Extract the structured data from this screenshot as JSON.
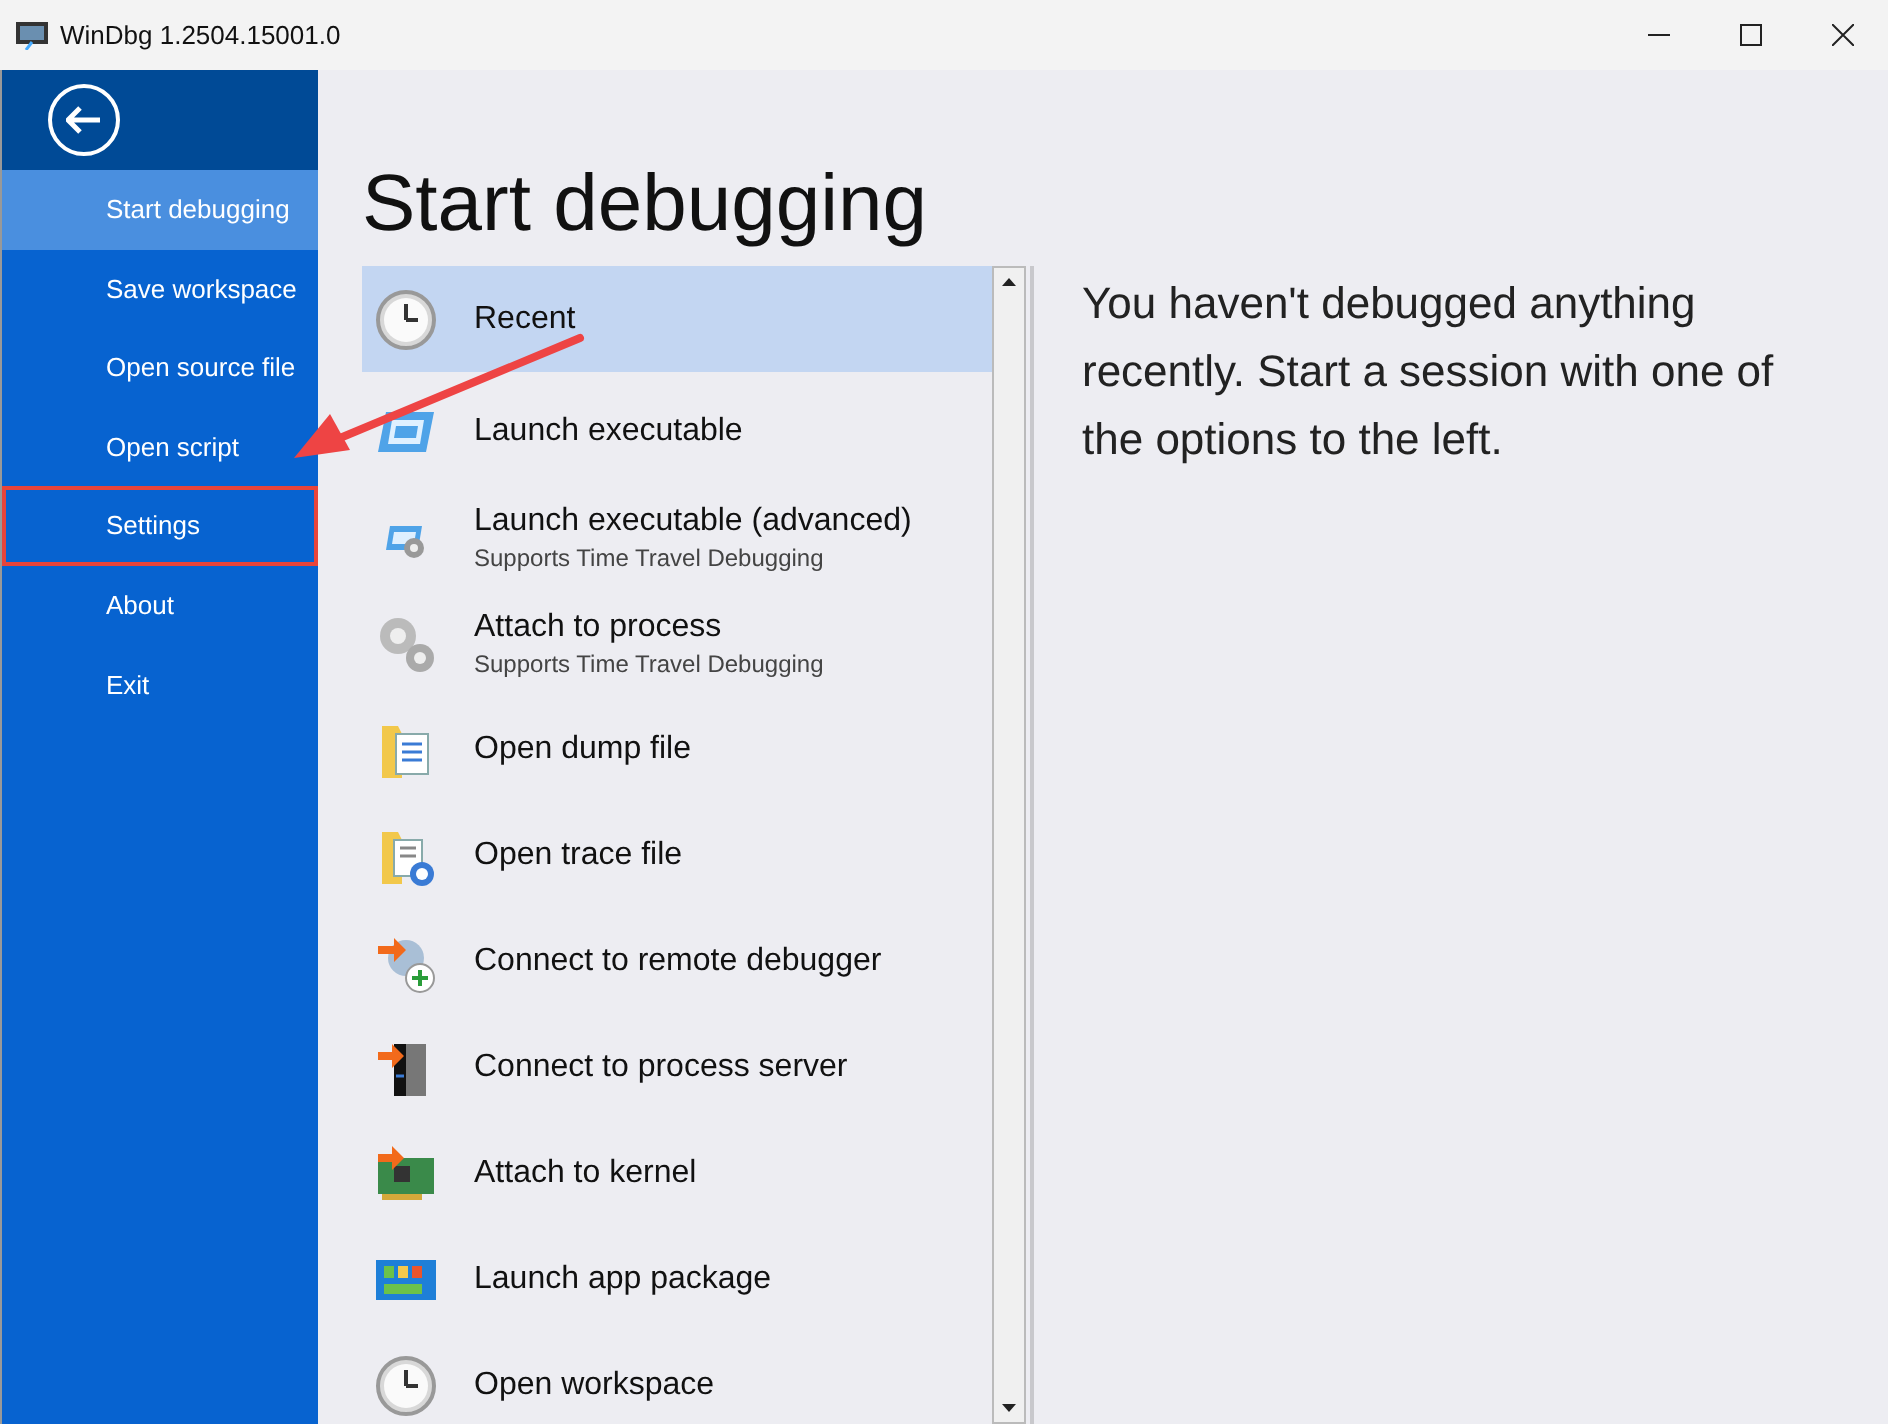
{
  "window": {
    "title": "WinDbg 1.2504.15001.0"
  },
  "sidebar": {
    "items": [
      {
        "label": "Start debugging",
        "selected": true,
        "highlighted": false
      },
      {
        "label": "Save workspace",
        "selected": false,
        "highlighted": false
      },
      {
        "label": "Open source file",
        "selected": false,
        "highlighted": false
      },
      {
        "label": "Open script",
        "selected": false,
        "highlighted": false
      },
      {
        "label": "Settings",
        "selected": false,
        "highlighted": true
      },
      {
        "label": "About",
        "selected": false,
        "highlighted": false
      },
      {
        "label": "Exit",
        "selected": false,
        "highlighted": false
      }
    ]
  },
  "heading": "Start debugging",
  "options": [
    {
      "label": "Recent",
      "selected": true
    },
    {
      "label": "Launch executable",
      "selected": false
    },
    {
      "label": "Launch executable (advanced)",
      "subtitle": "Supports Time Travel Debugging",
      "selected": false
    },
    {
      "label": "Attach to process",
      "subtitle": "Supports Time Travel Debugging",
      "selected": false
    },
    {
      "label": "Open dump file",
      "selected": false
    },
    {
      "label": "Open trace file",
      "selected": false
    },
    {
      "label": "Connect to remote debugger",
      "selected": false
    },
    {
      "label": "Connect to process server",
      "selected": false
    },
    {
      "label": "Attach to kernel",
      "selected": false
    },
    {
      "label": "Launch app package",
      "selected": false
    },
    {
      "label": "Open workspace",
      "selected": false
    }
  ],
  "message": "You haven't debugged anything recently. Start a session with one of the options to the left."
}
